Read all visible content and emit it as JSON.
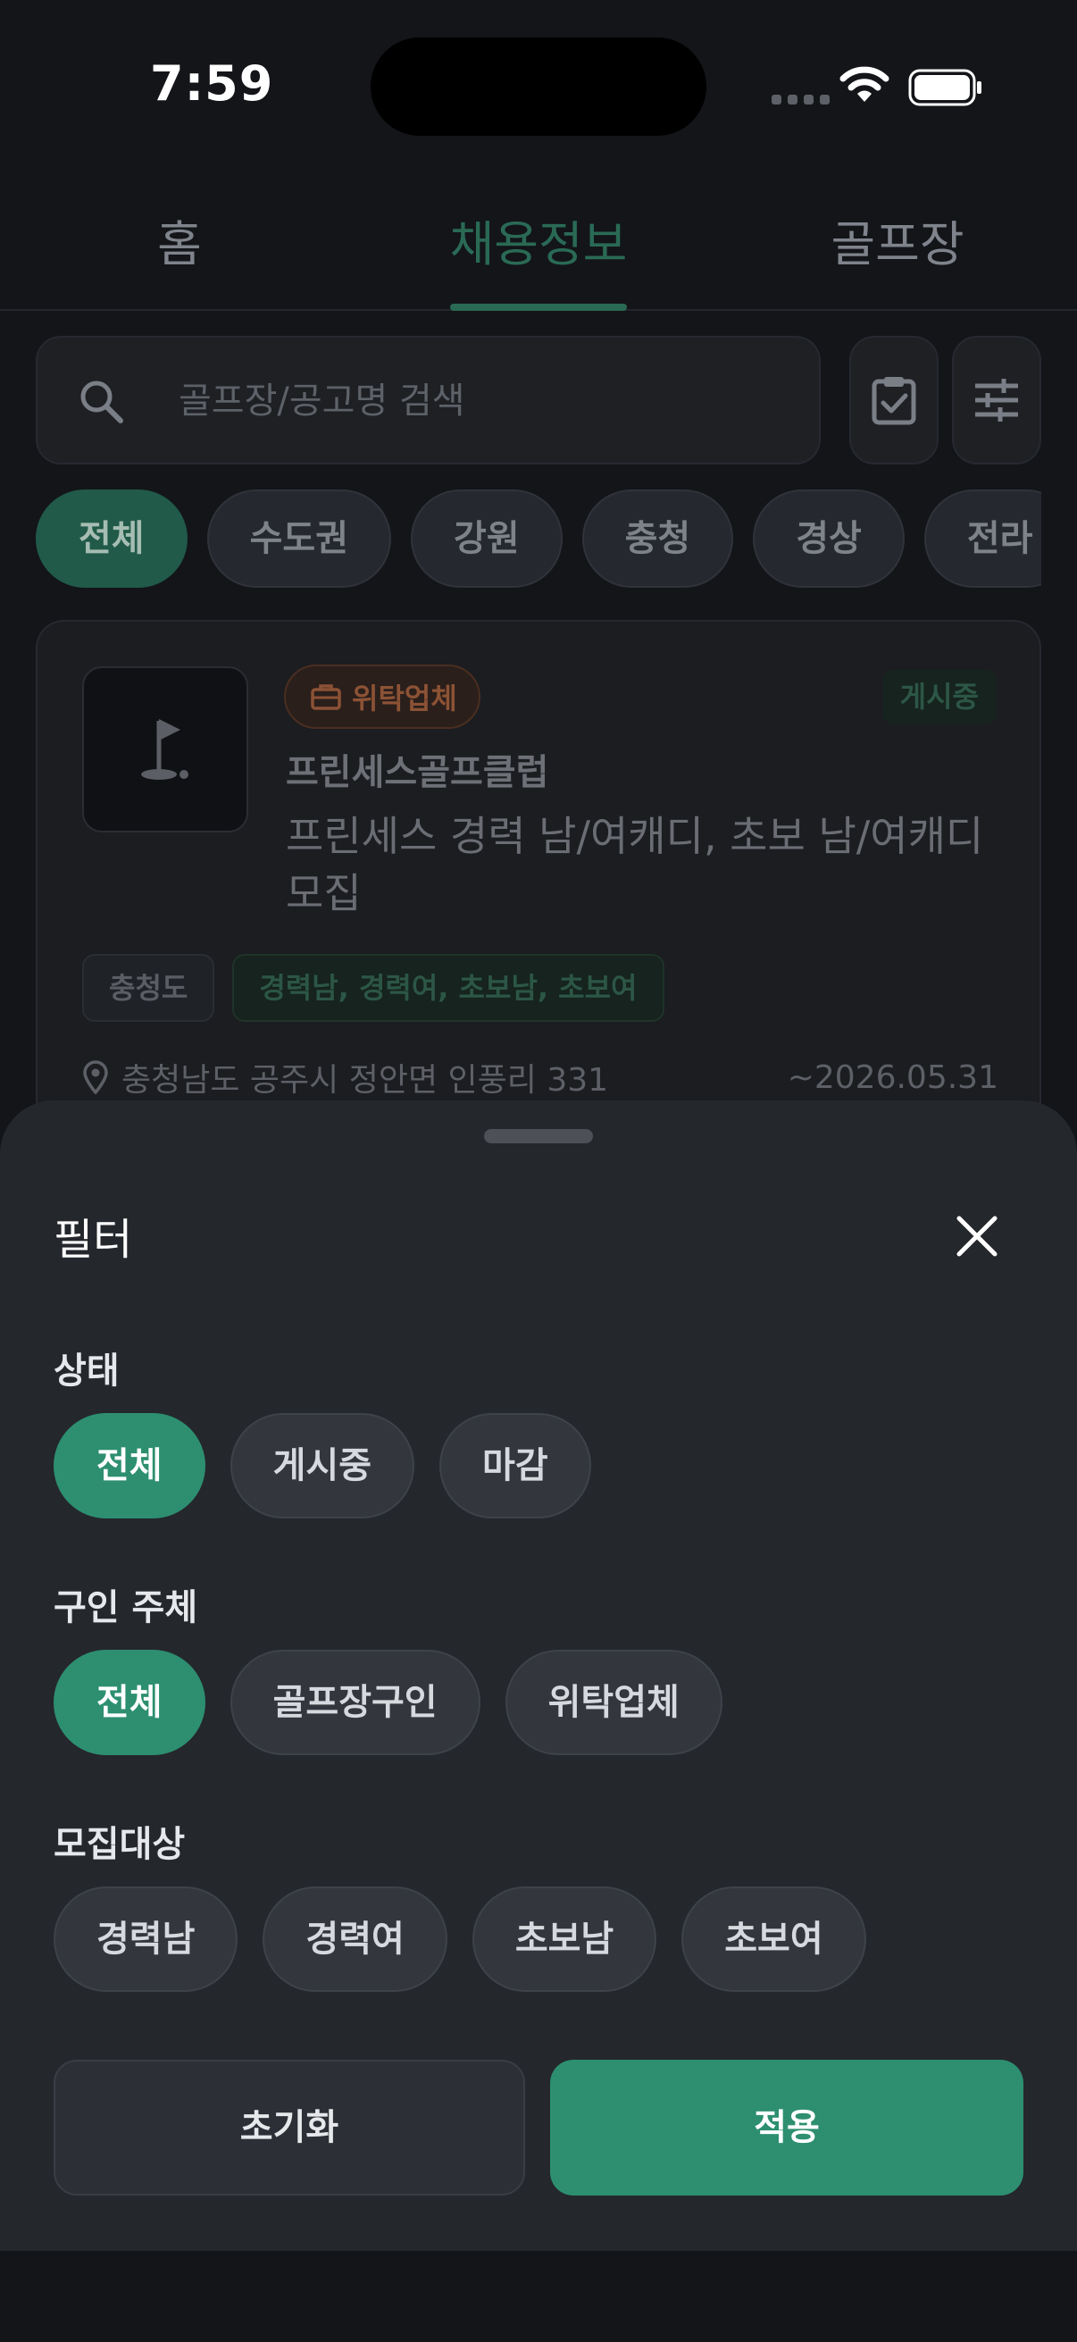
{
  "status_bar": {
    "time": "7:59"
  },
  "tabs": [
    {
      "label": "홈",
      "active": false
    },
    {
      "label": "채용정보",
      "active": true
    },
    {
      "label": "골프장",
      "active": false
    }
  ],
  "search": {
    "placeholder": "골프장/공고명 검색"
  },
  "region_filters": [
    {
      "label": "전체",
      "active": true
    },
    {
      "label": "수도권",
      "active": false
    },
    {
      "label": "강원",
      "active": false
    },
    {
      "label": "충청",
      "active": false
    },
    {
      "label": "경상",
      "active": false
    },
    {
      "label": "전라",
      "active": false
    }
  ],
  "job_card": {
    "company_type": "위탁업체",
    "status": "게시중",
    "company_name": "프린세스골프클럽",
    "title": "프린세스 경력 남/여캐디, 초보 남/여캐디 모집",
    "region_tag": "충청도",
    "target_tag": "경력남, 경력여, 초보남, 초보여",
    "address": "충청남도 공주시 정안면 인풍리 331",
    "deadline": "~2026.05.31"
  },
  "filter_sheet": {
    "title": "필터",
    "status_section": {
      "label": "상태",
      "options": [
        {
          "label": "전체",
          "active": true
        },
        {
          "label": "게시중",
          "active": false
        },
        {
          "label": "마감",
          "active": false
        }
      ]
    },
    "employer_section": {
      "label": "구인 주체",
      "options": [
        {
          "label": "전체",
          "active": true
        },
        {
          "label": "골프장구인",
          "active": false
        },
        {
          "label": "위탁업체",
          "active": false
        }
      ]
    },
    "target_section": {
      "label": "모집대상",
      "options": [
        {
          "label": "경력남",
          "active": false
        },
        {
          "label": "경력여",
          "active": false
        },
        {
          "label": "초보남",
          "active": false
        },
        {
          "label": "초보여",
          "active": false
        }
      ]
    },
    "reset_label": "초기화",
    "apply_label": "적용"
  },
  "colors": {
    "accent": "#2d8f70",
    "background": "#131519",
    "sheet": "#24272c"
  }
}
